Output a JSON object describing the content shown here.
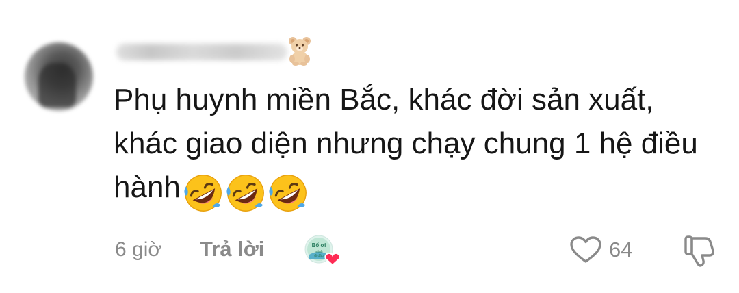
{
  "comment": {
    "text": "Phụ huynh miền Bắc, khác đời sản xuất, khác giao diện nhưng chạy chung 1 hệ điều hành",
    "reaction_emojis": [
      "rolling-on-floor-laughing",
      "rolling-on-floor-laughing",
      "rolling-on-floor-laughing"
    ],
    "username_badge_icon": "teddy-bear-icon"
  },
  "footer": {
    "timestamp": "6 giờ",
    "reply_label": "Trả lời",
    "creator_like_icon": "creator-avatar-with-heart-icon",
    "like_count": "64",
    "like_icon": "heart-outline-icon",
    "dislike_icon": "thumbs-down-outline-icon"
  },
  "colors": {
    "text": "#161616",
    "muted": "#8a8a8a",
    "heart_accent": "#fe2c55"
  }
}
